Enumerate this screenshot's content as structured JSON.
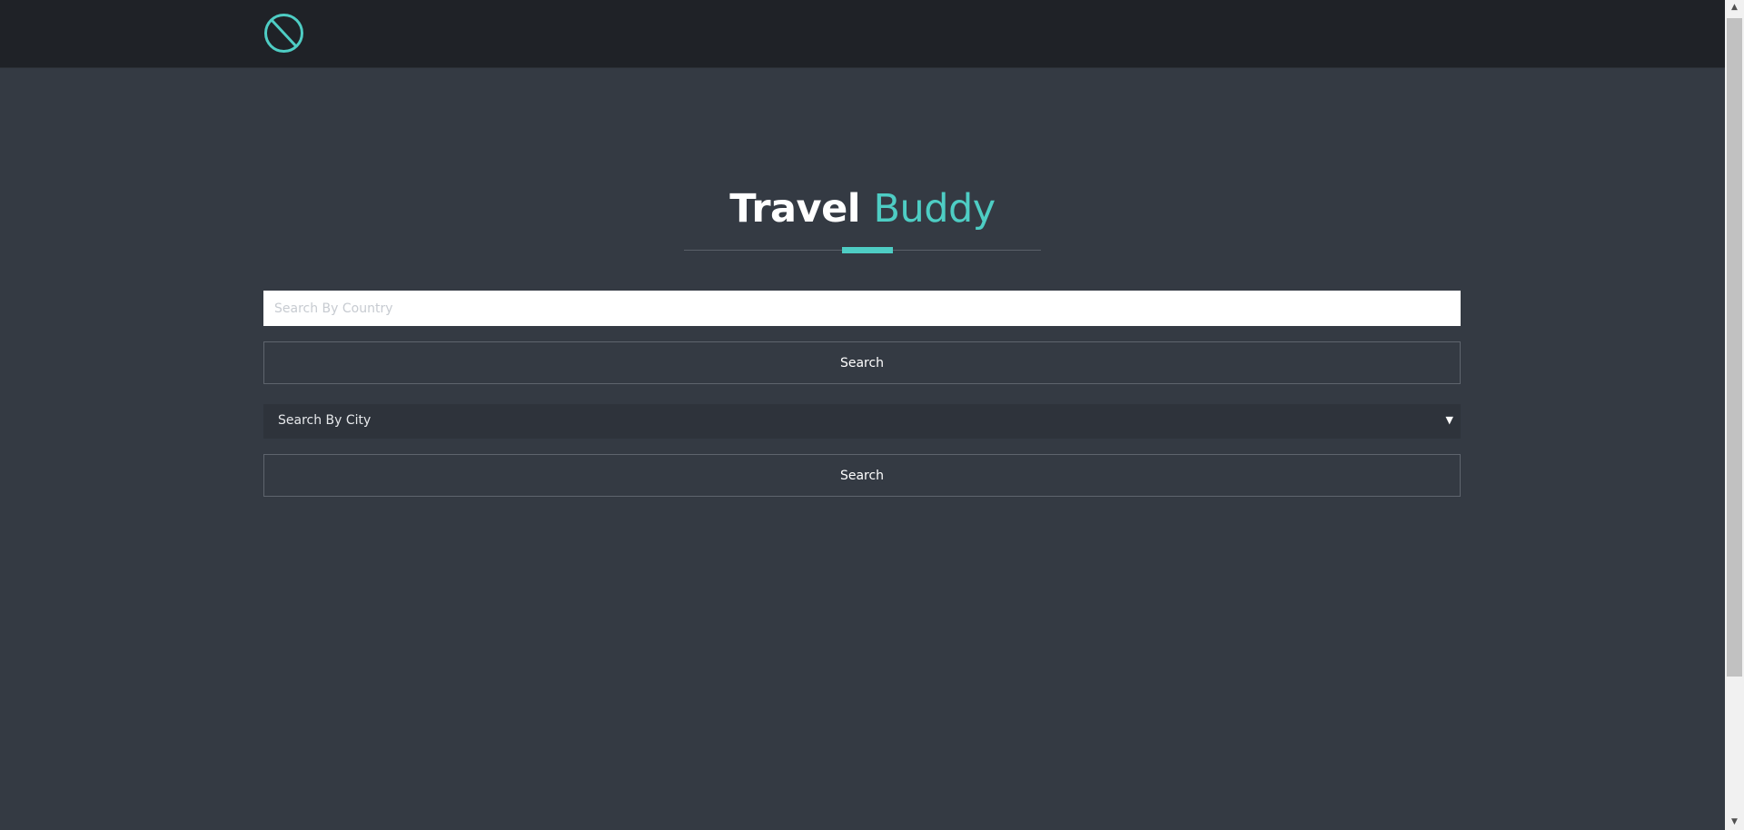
{
  "header": {
    "logo_icon": "globe-slash-icon",
    "accent_color": "#4ecdc4"
  },
  "hero": {
    "title_main": "Travel",
    "title_accent": "Buddy"
  },
  "country_search": {
    "placeholder": "Search By Country",
    "value": "",
    "button_label": "Search"
  },
  "city_search": {
    "selected": "Search By City",
    "arrow_icon": "caret-down-icon",
    "button_label": "Search"
  },
  "scrollbar": {
    "up_icon": "scroll-up-arrow-icon",
    "down_icon": "scroll-down-arrow-icon"
  }
}
